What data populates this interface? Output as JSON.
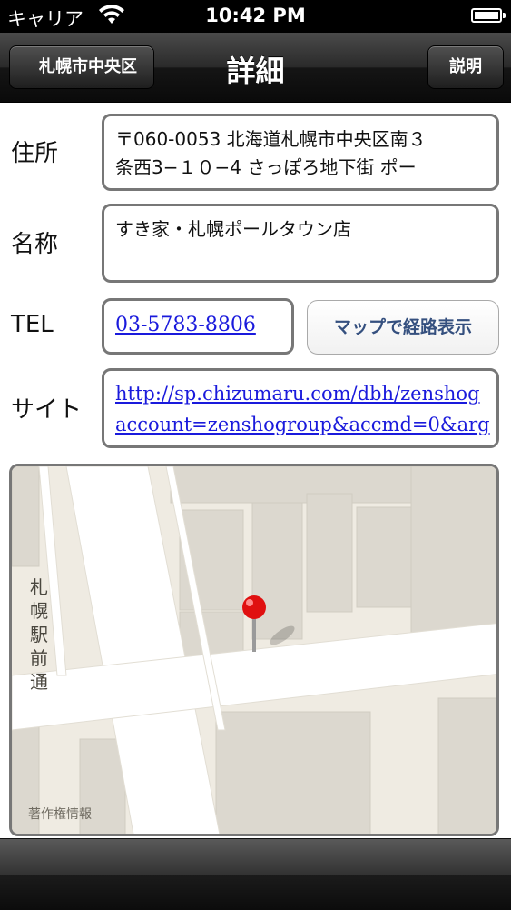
{
  "status_bar": {
    "carrier": "キャリア",
    "time": "10:42 PM"
  },
  "nav": {
    "back_label": "札幌市中央区",
    "title": "詳細",
    "help_label": "説明"
  },
  "address": {
    "label": "住所",
    "line1": "〒060-0053 北海道札幌市中央区南３",
    "line2": "条西3−１０−4 さっぽろ地下街 ポー"
  },
  "name": {
    "label": "名称",
    "value": "すき家・札幌ポールタウン店"
  },
  "tel": {
    "label": "TEL",
    "value": "03-5783-8806",
    "route_button": "マップで経路表示"
  },
  "site": {
    "label": "サイト",
    "line1": "http://sp.chizumaru.com/dbh/zenshog",
    "line2": "account=zenshogroup&accmd=0&arg"
  },
  "map": {
    "street_label": "札幌駅前通",
    "copyright": "著作権情報"
  },
  "colors": {
    "link": "#1a1adc",
    "route_button_text": "#35507f",
    "pin": "#e01010"
  }
}
